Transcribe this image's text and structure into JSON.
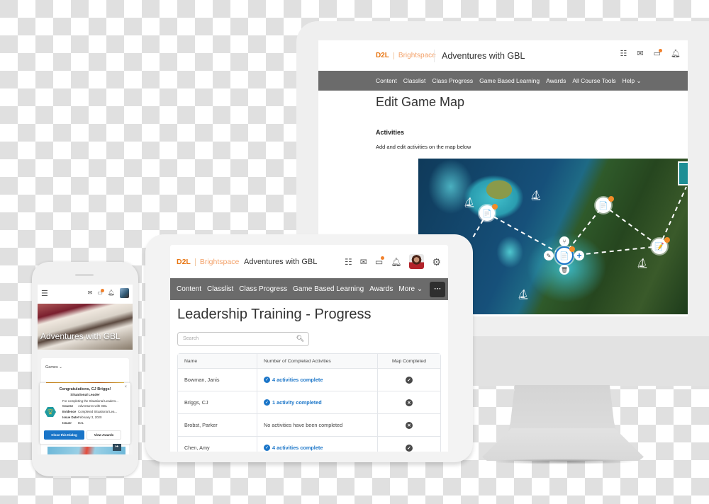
{
  "brand": {
    "logo": "D2L",
    "product": "Brightspace"
  },
  "course_title": "Adventures with GBL",
  "desktop": {
    "nav": [
      "Content",
      "Classlist",
      "Class Progress",
      "Game Based Learning",
      "Awards",
      "All Course Tools",
      "Help ⌄"
    ],
    "page_title": "Edit Game Map",
    "section_title": "Activities",
    "section_desc": "Add and edit activities on the map below",
    "icons": [
      "apps-grid-icon",
      "mail-icon",
      "chat-icon",
      "bell-icon"
    ],
    "map": {
      "nodes": [
        {
          "name": "activity-node-1",
          "icon": "📄"
        },
        {
          "name": "activity-node-2",
          "icon": "📄"
        },
        {
          "name": "activity-node-selected",
          "icon": "📄"
        },
        {
          "name": "activity-node-4",
          "icon": "📝"
        }
      ],
      "tools": {
        "edit": "✎",
        "branch": "⑂",
        "delete": "🗑",
        "add": "+"
      }
    }
  },
  "tablet": {
    "nav": [
      "Content",
      "Classlist",
      "Class Progress",
      "Game Based Learning",
      "Awards",
      "More ⌄"
    ],
    "more_button": "···",
    "page_title": "Leadership Training - Progress",
    "search_placeholder": "Search",
    "table": {
      "headers": [
        "Name",
        "Number of Completed Activities",
        "Map Completed"
      ],
      "rows": [
        {
          "name": "Bowman, Janis",
          "activities": "4 activities complete",
          "linked": true,
          "map_completed": true
        },
        {
          "name": "Briggs, CJ",
          "activities": "1 activity completed",
          "linked": true,
          "map_completed": false
        },
        {
          "name": "Brobst, Parker",
          "activities": "No activities have been completed",
          "linked": false,
          "map_completed": false
        },
        {
          "name": "Chen, Amy",
          "activities": "4 activities complete",
          "linked": true,
          "map_completed": true
        }
      ]
    }
  },
  "phone": {
    "hero_title": "Adventures with GBL",
    "games_label": "Games",
    "dialog": {
      "title": "Congratulations, CJ Briggs!",
      "award_name": "Situational Leader",
      "description": "For completing the Situational Leaders...",
      "fields": [
        {
          "key": "Course",
          "value": "Adventures with GBL"
        },
        {
          "key": "Evidence",
          "value": "Completed Situational Lea..."
        },
        {
          "key": "Issue Date",
          "value": "February 3, 2020"
        },
        {
          "key": "Issuer",
          "value": "D2L"
        }
      ],
      "close_label": "Close this Dialog",
      "view_label": "View Awards",
      "close_icon": "×"
    }
  },
  "colors": {
    "brand_orange": "#e87511",
    "nav_gray": "#6b6b6b",
    "link_blue": "#1a75c8",
    "badge_orange": "#f28c28"
  }
}
